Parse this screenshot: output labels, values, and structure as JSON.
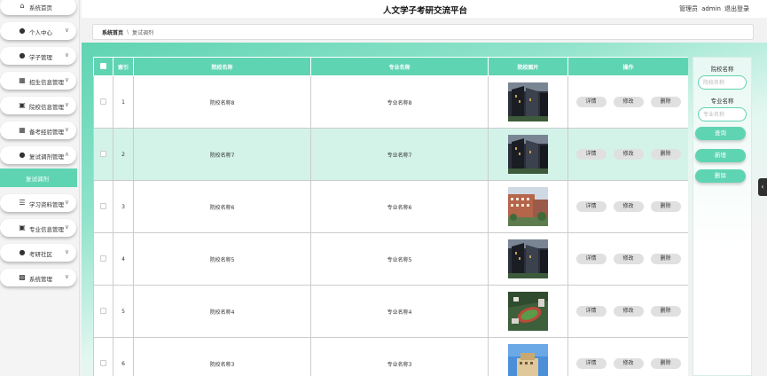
{
  "header": {
    "title": "人文学子考研交流平台",
    "role_label": "管理员",
    "username": "admin",
    "logout_label": "退出登录"
  },
  "breadcrumb": {
    "home": "系统首页",
    "separator": "\\",
    "current": "复试调剂"
  },
  "sidebar": {
    "items": [
      {
        "label": "系统首页",
        "icon": "home-icon"
      },
      {
        "label": "个人中心",
        "icon": "user-icon",
        "chevron": "chevron-down-icon"
      },
      {
        "label": "学子管理",
        "icon": "users-icon",
        "chevron": "chevron-down-icon"
      },
      {
        "label": "招生信息管理",
        "icon": "grid-icon",
        "chevron": "chevron-down-icon"
      },
      {
        "label": "院校信息管理",
        "icon": "book-icon",
        "chevron": "chevron-down-icon"
      },
      {
        "label": "备考经验管理",
        "icon": "grid-icon",
        "chevron": "chevron-down-icon"
      },
      {
        "label": "复试调剂管理",
        "icon": "user-icon",
        "chevron": "chevron-up-icon"
      },
      {
        "label": "学习资料管理",
        "icon": "list-icon",
        "chevron": "chevron-down-icon"
      },
      {
        "label": "专业信息管理",
        "icon": "book-icon",
        "chevron": "chevron-down-icon"
      },
      {
        "label": "考研社区",
        "icon": "user-icon",
        "chevron": "chevron-down-icon"
      },
      {
        "label": "系统管理",
        "icon": "chart-icon",
        "chevron": "chevron-down-icon"
      }
    ],
    "active_sub": "复试调剂"
  },
  "table": {
    "columns": [
      "索引",
      "院校名称",
      "专业名称",
      "院校图片",
      "操作"
    ],
    "rows": [
      {
        "index": "1",
        "school": "院校名称8",
        "major": "专业名称8",
        "image": "photo-dark-building"
      },
      {
        "index": "2",
        "school": "院校名称7",
        "major": "专业名称7",
        "image": "photo-dark-building"
      },
      {
        "index": "3",
        "school": "院校名称6",
        "major": "专业名称6",
        "image": "photo-campus-building"
      },
      {
        "index": "4",
        "school": "院校名称5",
        "major": "专业名称5",
        "image": "photo-dark-building"
      },
      {
        "index": "5",
        "school": "院校名称4",
        "major": "专业名称4",
        "image": "photo-aerial-campus"
      },
      {
        "index": "6",
        "school": "院校名称3",
        "major": "专业名称3",
        "image": "photo-blue-sky-building"
      }
    ],
    "actions": {
      "detail": "详情",
      "edit": "修改",
      "delete": "删除"
    },
    "selected_row": 2
  },
  "search": {
    "school_label": "院校名称",
    "school_placeholder": "院校名称",
    "major_label": "专业名称",
    "major_placeholder": "专业名称",
    "query_button": "查询",
    "add_button": "新增",
    "delete_button": "删除"
  },
  "colors": {
    "accent": "#5fd4b2",
    "selected_row": "#d3f3e9"
  }
}
